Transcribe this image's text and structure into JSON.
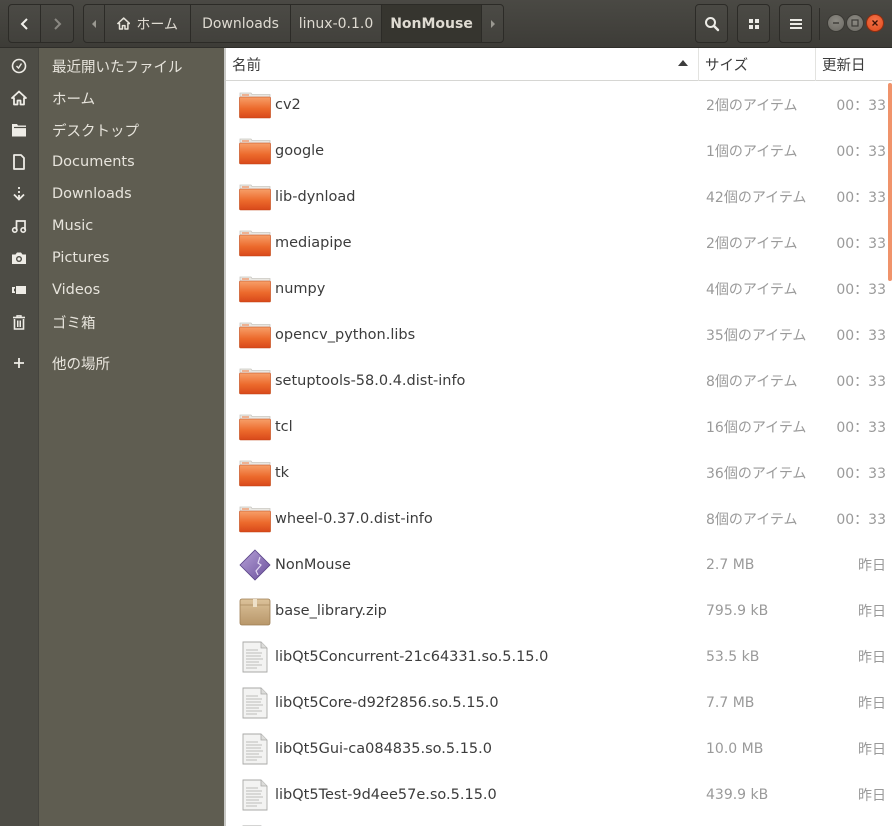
{
  "header": {
    "back_icon": "chevron-left-icon",
    "forward_icon": "chevron-right-icon",
    "path_left_icon": "triangle-left-icon",
    "path_right_icon": "triangle-right-icon",
    "breadcrumb": [
      {
        "label": "ホーム",
        "icon": "home-icon"
      },
      {
        "label": "Downloads"
      },
      {
        "label": "linux-0.1.0"
      },
      {
        "label": "NonMouse",
        "current": true
      }
    ],
    "search_icon": "search-icon",
    "view_icon": "grid-view-icon",
    "menu_icon": "hamburger-menu-icon",
    "window_controls": [
      "minimize",
      "maximize",
      "close"
    ],
    "close_color": "#e95420"
  },
  "sidebar": {
    "items": [
      {
        "label": "最近開いたファイル",
        "icon": "clock-icon"
      },
      {
        "label": "ホーム",
        "icon": "home-icon"
      },
      {
        "label": "デスクトップ",
        "icon": "folder-icon"
      },
      {
        "label": "Documents",
        "icon": "document-icon"
      },
      {
        "label": "Downloads",
        "icon": "download-icon"
      },
      {
        "label": "Music",
        "icon": "music-icon"
      },
      {
        "label": "Pictures",
        "icon": "camera-icon"
      },
      {
        "label": "Videos",
        "icon": "video-icon"
      },
      {
        "label": "ゴミ箱",
        "icon": "trash-icon"
      },
      {
        "label": "他の場所",
        "icon": "plus-icon"
      }
    ]
  },
  "columns": {
    "name": "名前",
    "size": "サイズ",
    "modified": "更新日",
    "sort": "ascending"
  },
  "files": [
    {
      "name": "cv2",
      "size": "2個のアイテム",
      "modified": "00：33",
      "type": "folder"
    },
    {
      "name": "google",
      "size": "1個のアイテム",
      "modified": "00：33",
      "type": "folder"
    },
    {
      "name": "lib-dynload",
      "size": "42個のアイテム",
      "modified": "00：33",
      "type": "folder"
    },
    {
      "name": "mediapipe",
      "size": "2個のアイテム",
      "modified": "00：33",
      "type": "folder"
    },
    {
      "name": "numpy",
      "size": "4個のアイテム",
      "modified": "00：33",
      "type": "folder"
    },
    {
      "name": "opencv_python.libs",
      "size": "35個のアイテム",
      "modified": "00：33",
      "type": "folder"
    },
    {
      "name": "setuptools-58.0.4.dist-info",
      "size": "8個のアイテム",
      "modified": "00：33",
      "type": "folder"
    },
    {
      "name": "tcl",
      "size": "16個のアイテム",
      "modified": "00：33",
      "type": "folder"
    },
    {
      "name": "tk",
      "size": "36個のアイテム",
      "modified": "00：33",
      "type": "folder"
    },
    {
      "name": "wheel-0.37.0.dist-info",
      "size": "8個のアイテム",
      "modified": "00：33",
      "type": "folder"
    },
    {
      "name": "NonMouse",
      "size": "2.7 MB",
      "modified": "昨日",
      "type": "executable"
    },
    {
      "name": "base_library.zip",
      "size": "795.9 kB",
      "modified": "昨日",
      "type": "archive"
    },
    {
      "name": "libQt5Concurrent-21c64331.so.5.15.0",
      "size": "53.5 kB",
      "modified": "昨日",
      "type": "text"
    },
    {
      "name": "libQt5Core-d92f2856.so.5.15.0",
      "size": "7.7 MB",
      "modified": "昨日",
      "type": "text"
    },
    {
      "name": "libQt5Gui-ca084835.so.5.15.0",
      "size": "10.0 MB",
      "modified": "昨日",
      "type": "text"
    },
    {
      "name": "libQt5Test-9d4ee57e.so.5.15.0",
      "size": "439.9 kB",
      "modified": "昨日",
      "type": "text"
    },
    {
      "name": "",
      "size": "",
      "modified": "",
      "type": "text"
    }
  ],
  "colors": {
    "accent": "#f0936b",
    "sidebar_bg": "#5f5d51",
    "headerbar_bg": "#3d3c37",
    "folder_orange": "#e8541f"
  }
}
